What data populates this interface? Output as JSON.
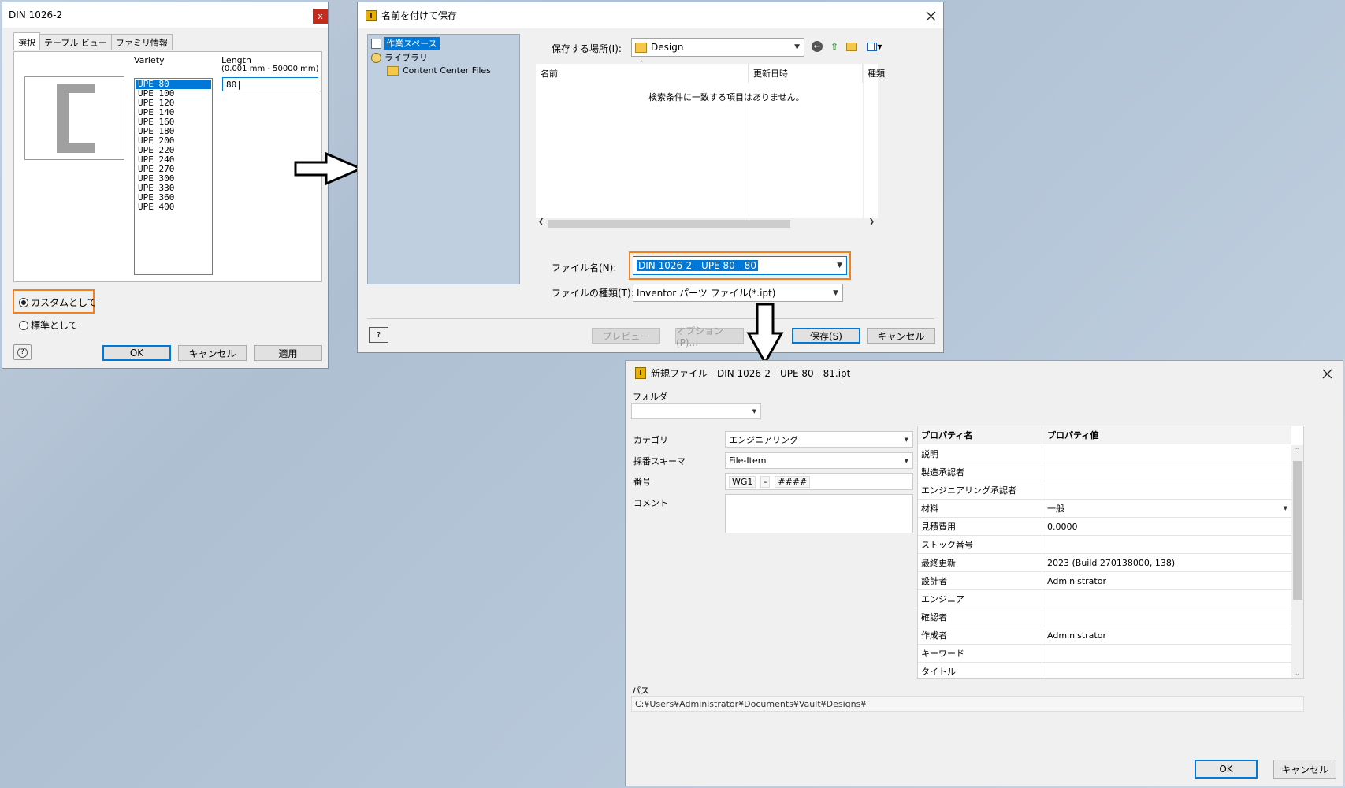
{
  "dlg_select": {
    "title": "DIN 1026-2",
    "close": "x",
    "tabs": [
      "選択",
      "テーブル ビュー",
      "ファミリ情報"
    ],
    "variety_label": "Variety",
    "length_label": "Length",
    "length_range": "(0.001 mm - 50000 mm)",
    "length_value": "80",
    "varieties": [
      "UPE 80",
      "UPE 100",
      "UPE 120",
      "UPE 140",
      "UPE 160",
      "UPE 180",
      "UPE 200",
      "UPE 220",
      "UPE 240",
      "UPE 270",
      "UPE 300",
      "UPE 330",
      "UPE 360",
      "UPE 400"
    ],
    "selected_variety": "UPE 80",
    "radio_custom": "カスタムとして",
    "radio_standard": "標準として",
    "help": "?",
    "ok": "OK",
    "cancel": "キャンセル",
    "apply": "適用"
  },
  "dlg_save": {
    "title": "名前を付けて保存",
    "tree": [
      "作業スペース",
      "ライブラリ",
      "Content Center Files"
    ],
    "location_label": "保存する場所(I):",
    "location_value": "Design",
    "col_name": "名前",
    "col_date": "更新日時",
    "col_type": "種類",
    "empty_message": "検索条件に一致する項目はありません。",
    "filename_label": "ファイル名(N):",
    "filename_value": "DIN 1026-2 - UPE 80 - 80",
    "filetype_label": "ファイルの種類(T):",
    "filetype_value": "Inventor パーツ ファイル(*.ipt)",
    "preview": "プレビュー",
    "options": "オプション(P)...",
    "save": "保存(S)",
    "cancel": "キャンセル"
  },
  "dlg_newfile": {
    "title": "新規ファイル - DIN 1026-2 - UPE 80 - 81.ipt",
    "folder_label": "フォルダ",
    "category_label": "カテゴリ",
    "category_value": "エンジニアリング",
    "scheme_label": "採番スキーマ",
    "scheme_value": "File-Item",
    "number_label": "番号",
    "number_prefix": "WG1",
    "number_sep": "-",
    "number_pattern": "####",
    "comment_label": "コメント",
    "prop_header_name": "プロパティ名",
    "prop_header_value": "プロパティ値",
    "properties": [
      {
        "name": "説明",
        "value": ""
      },
      {
        "name": "製造承認者",
        "value": ""
      },
      {
        "name": "エンジニアリング承認者",
        "value": ""
      },
      {
        "name": "材料",
        "value": "一般"
      },
      {
        "name": "見積費用",
        "value": "0.0000"
      },
      {
        "name": "ストック番号",
        "value": ""
      },
      {
        "name": "最終更新",
        "value": "2023 (Build 270138000, 138)"
      },
      {
        "name": "設計者",
        "value": "Administrator"
      },
      {
        "name": "エンジニア",
        "value": ""
      },
      {
        "name": "確認者",
        "value": ""
      },
      {
        "name": "作成者",
        "value": "Administrator"
      },
      {
        "name": "キーワード",
        "value": ""
      },
      {
        "name": "タイトル",
        "value": ""
      }
    ],
    "path_label": "パス",
    "path_value": "C:¥Users¥Administrator¥Documents¥Vault¥Designs¥",
    "ok": "OK",
    "cancel": "キャンセル"
  },
  "colors": {
    "accent": "#0078d7",
    "highlight": "#f08020",
    "tree_bg": "#bfcfdf"
  }
}
